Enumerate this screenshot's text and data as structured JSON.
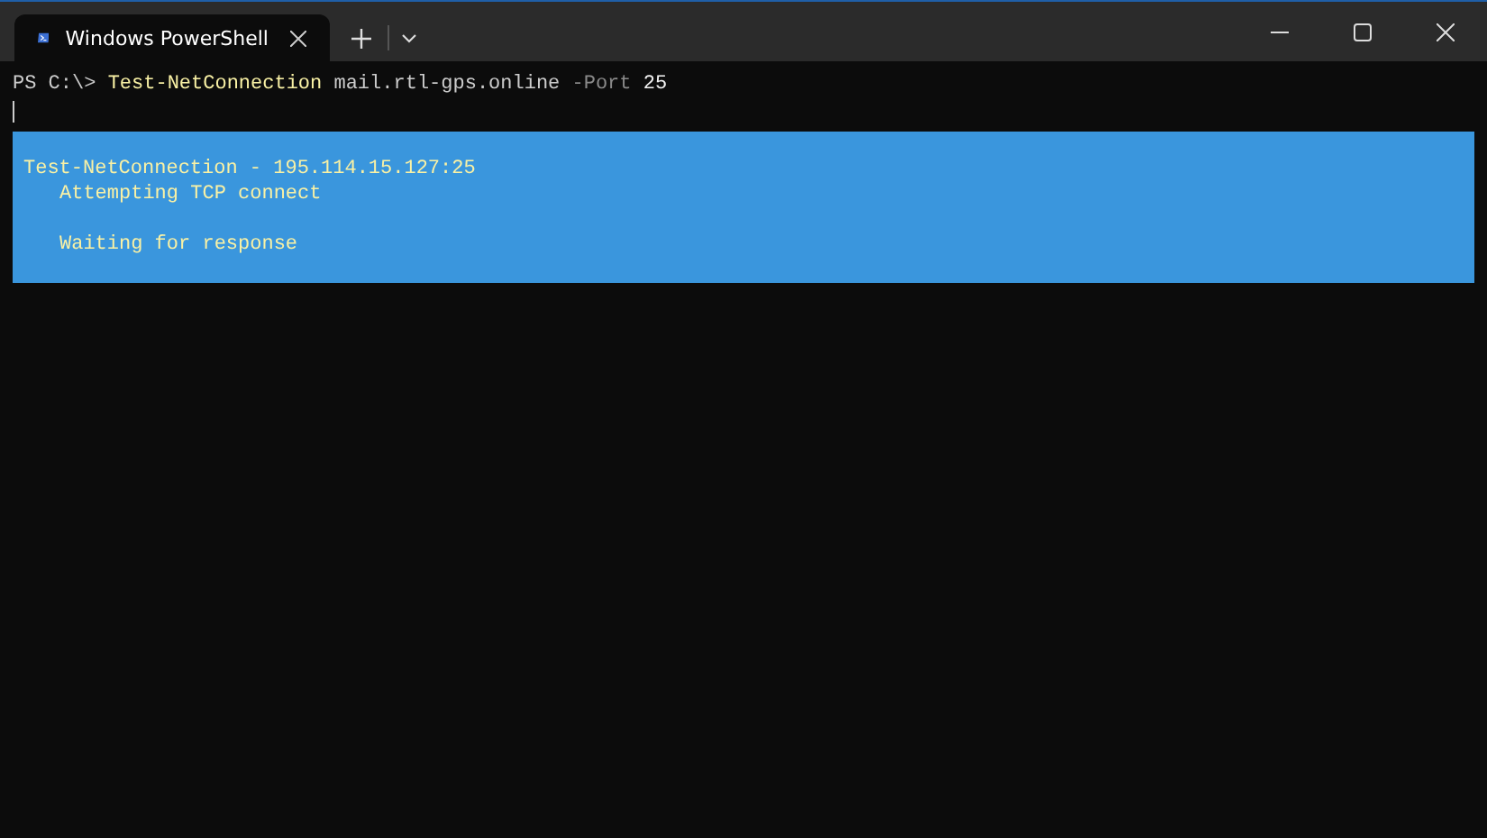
{
  "window": {
    "tabs": [
      {
        "title": "Windows PowerShell",
        "selected": true
      }
    ]
  },
  "terminal": {
    "command": [
      {
        "kind": "prompt",
        "text": "PS C:\\>"
      },
      {
        "kind": "cmdlet",
        "text": "Test-NetConnection"
      },
      {
        "kind": "argument",
        "text": "mail.rtl-gps.online"
      },
      {
        "kind": "parameter",
        "text": "-Port"
      },
      {
        "kind": "number",
        "text": "25"
      }
    ],
    "progress": {
      "activity": "Test-NetConnection - 195.114.15.127:25",
      "lines": [
        "Attempting TCP connect",
        "Waiting for response"
      ]
    }
  }
}
